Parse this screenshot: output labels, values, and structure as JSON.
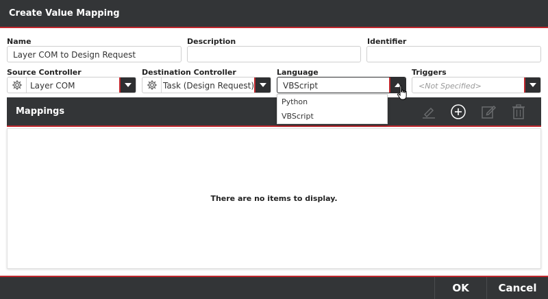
{
  "dialog": {
    "title": "Create Value Mapping"
  },
  "fields": {
    "name": {
      "label": "Name",
      "value": "Layer COM to Design Request"
    },
    "description": {
      "label": "Description",
      "value": ""
    },
    "identifier": {
      "label": "Identifier",
      "value": ""
    },
    "source_controller": {
      "label": "Source Controller",
      "value": "Layer COM",
      "icon": "gear-icon"
    },
    "destination_controller": {
      "label": "Destination Controller",
      "value": "Task (Design Request)",
      "icon": "gear-icon"
    },
    "language": {
      "label": "Language",
      "value": "VBScript",
      "options": [
        "Python",
        "VBScript"
      ]
    },
    "triggers": {
      "label": "Triggers",
      "placeholder": "<Not Specified>"
    }
  },
  "mappings": {
    "title": "Mappings",
    "toolbar": [
      "eraser-icon",
      "add-circle-icon",
      "edit-icon",
      "trash-icon"
    ],
    "empty_message": "There are no items to display."
  },
  "footer": {
    "ok_label": "OK",
    "cancel_label": "Cancel"
  },
  "colors": {
    "header_bg": "#333537",
    "accent": "#c0272d"
  }
}
